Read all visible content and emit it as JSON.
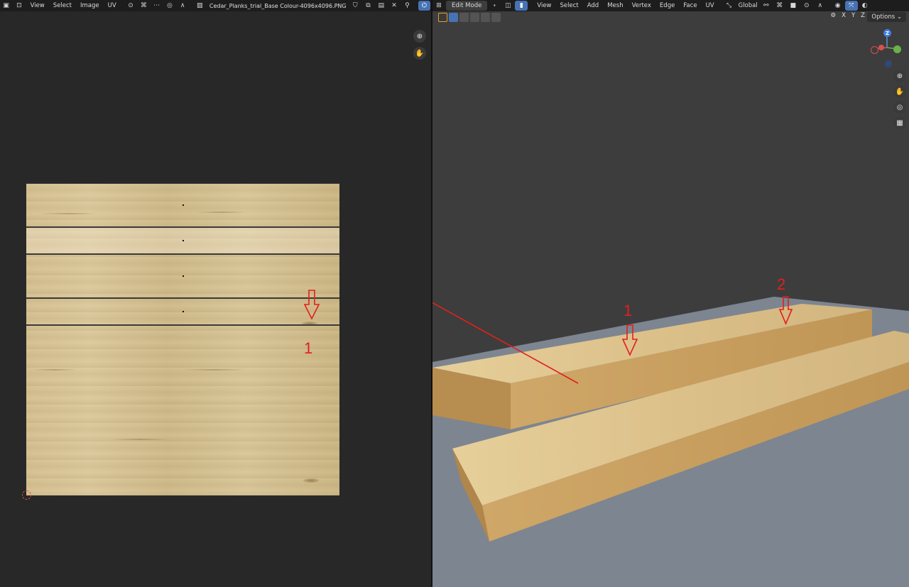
{
  "uv_header": {
    "menus": [
      "View",
      "Select",
      "Image",
      "UV"
    ],
    "image_name": "Cedar_Planks_trial_Base Colour-4096x4096.PNG"
  },
  "viewport_header": {
    "mode": "Edit Mode",
    "menus": [
      "View",
      "Select",
      "Add",
      "Mesh",
      "Vertex",
      "Edge",
      "Face",
      "UV"
    ],
    "transform_orientation": "Global",
    "axes": [
      "X",
      "Y",
      "Z"
    ],
    "options_label": "Options"
  },
  "gizmo": {
    "z_label": "Z"
  },
  "annotations": {
    "uv_marker_label": "1",
    "viewport_marker_1_label": "1",
    "viewport_marker_2_label": "2"
  },
  "colors": {
    "annotation_red": "#e2201c",
    "active_blue": "#4772b3",
    "viewport_bg": "#3d3d3d",
    "uv_bg": "#282828",
    "ground_plane": "#7d8590"
  },
  "icons": [
    "editor-type-icon",
    "pin-icon",
    "close-icon",
    "zoom-icon",
    "hand-icon",
    "camera-icon",
    "grid-icon",
    "snap-icon",
    "overlay-icon"
  ]
}
